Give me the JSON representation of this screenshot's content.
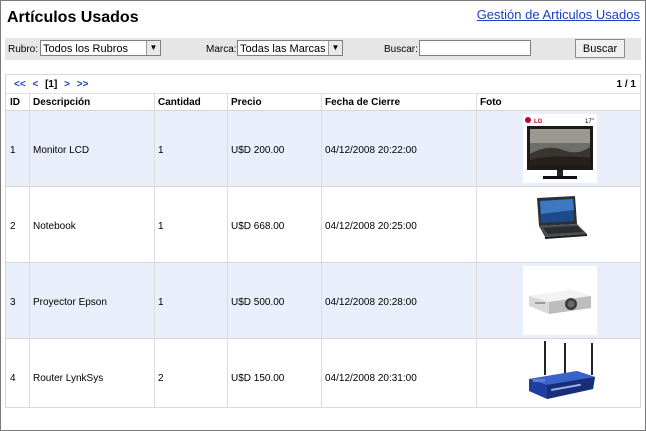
{
  "header": {
    "title": "Artículos Usados",
    "admin_link": "Gestión de Articulos Usados"
  },
  "filters": {
    "rubro_label": "Rubro:",
    "rubro_selected": "Todos los Rubros",
    "marca_label": "Marca:",
    "marca_selected": "Todas las Marcas",
    "buscar_label": "Buscar:",
    "buscar_value": "",
    "search_button": "Buscar"
  },
  "pager": {
    "first": "<<",
    "prev": "<",
    "current": "[1]",
    "next": ">",
    "last": ">>",
    "page_count": "1 / 1"
  },
  "table": {
    "columns": [
      "ID",
      "Descripción",
      "Cantidad",
      "Precio",
      "Fecha de Cierre",
      "Foto"
    ],
    "rows": [
      {
        "id": "1",
        "descripcion": "Monitor LCD",
        "cantidad": "1",
        "precio": "U$D 200.00",
        "fecha": "04/12/2008 20:22:00",
        "foto": "monitor-image",
        "foto_brand": "LG",
        "foto_size": "17\""
      },
      {
        "id": "2",
        "descripcion": "Notebook",
        "cantidad": "1",
        "precio": "U$D 668.00",
        "fecha": "04/12/2008 20:25:00",
        "foto": "notebook-image"
      },
      {
        "id": "3",
        "descripcion": "Proyector Epson",
        "cantidad": "1",
        "precio": "U$D 500.00",
        "fecha": "04/12/2008 20:28:00",
        "foto": "projector-image"
      },
      {
        "id": "4",
        "descripcion": "Router LynkSys",
        "cantidad": "2",
        "precio": "U$D 150.00",
        "fecha": "04/12/2008 20:31:00",
        "foto": "router-image"
      }
    ]
  },
  "colors": {
    "link": "#1a3fbf",
    "filter_bar": "#e6e6e6",
    "alt_row": "#e8eefa"
  }
}
